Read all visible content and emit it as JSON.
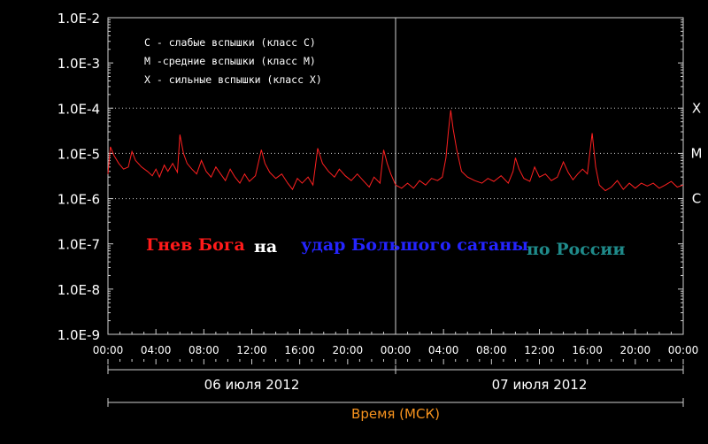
{
  "chart_data": {
    "type": "line",
    "y_scale": "log",
    "ylim": [
      1e-09,
      0.01
    ],
    "xlim_hours": [
      0,
      48
    ],
    "y_tick_labels": [
      "1.0E-2",
      "1.0E-3",
      "1.0E-4",
      "1.0E-5",
      "1.0E-6",
      "1.0E-7",
      "1.0E-8",
      "1.0E-9"
    ],
    "x_tick_labels": [
      "00:00",
      "04:00",
      "08:00",
      "12:00",
      "16:00",
      "20:00",
      "00:00",
      "04:00",
      "08:00",
      "12:00",
      "16:00",
      "20:00",
      "00:00"
    ],
    "class_levels": [
      {
        "label": "X",
        "value": 0.0001
      },
      {
        "label": "M",
        "value": 1e-05
      },
      {
        "label": "C",
        "value": 1e-06
      }
    ],
    "legend": [
      "C - слабые вспышки (класс C)",
      "M -средние вспышки (класс M)",
      "X - сильные вспышки (класс X)"
    ],
    "date_labels": [
      "06 июля 2012",
      "07 июля 2012"
    ],
    "xlabel": "Время (МСК)",
    "series": [
      {
        "color": "#ff2020",
        "points": [
          [
            0.0,
            3.5e-06
          ],
          [
            0.2,
            1.4e-05
          ],
          [
            0.5,
            9e-06
          ],
          [
            0.9,
            6e-06
          ],
          [
            1.3,
            4.5e-06
          ],
          [
            1.7,
            5e-06
          ],
          [
            2.0,
            1.1e-05
          ],
          [
            2.3,
            7e-06
          ],
          [
            2.8,
            5e-06
          ],
          [
            3.3,
            4e-06
          ],
          [
            3.7,
            3.2e-06
          ],
          [
            4.0,
            4.5e-06
          ],
          [
            4.3,
            3e-06
          ],
          [
            4.7,
            5.5e-06
          ],
          [
            5.0,
            4e-06
          ],
          [
            5.4,
            6e-06
          ],
          [
            5.8,
            3.8e-06
          ],
          [
            6.0,
            2.6e-05
          ],
          [
            6.3,
            1e-05
          ],
          [
            6.6,
            6e-06
          ],
          [
            7.0,
            4.5e-06
          ],
          [
            7.4,
            3.5e-06
          ],
          [
            7.8,
            7e-06
          ],
          [
            8.2,
            4e-06
          ],
          [
            8.6,
            3e-06
          ],
          [
            9.0,
            5e-06
          ],
          [
            9.4,
            3.5e-06
          ],
          [
            9.8,
            2.5e-06
          ],
          [
            10.2,
            4.5e-06
          ],
          [
            10.6,
            3e-06
          ],
          [
            11.0,
            2.2e-06
          ],
          [
            11.4,
            3.5e-06
          ],
          [
            11.8,
            2.4e-06
          ],
          [
            12.3,
            3.2e-06
          ],
          [
            12.8,
            1.2e-05
          ],
          [
            13.1,
            6e-06
          ],
          [
            13.5,
            3.8e-06
          ],
          [
            14.0,
            2.8e-06
          ],
          [
            14.5,
            3.5e-06
          ],
          [
            15.0,
            2.2e-06
          ],
          [
            15.4,
            1.6e-06
          ],
          [
            15.8,
            2.8e-06
          ],
          [
            16.2,
            2.2e-06
          ],
          [
            16.7,
            3e-06
          ],
          [
            17.1,
            2e-06
          ],
          [
            17.5,
            1.3e-05
          ],
          [
            17.9,
            6e-06
          ],
          [
            18.4,
            4e-06
          ],
          [
            18.9,
            3e-06
          ],
          [
            19.3,
            4.5e-06
          ],
          [
            19.8,
            3.2e-06
          ],
          [
            20.3,
            2.5e-06
          ],
          [
            20.8,
            3.5e-06
          ],
          [
            21.3,
            2.5e-06
          ],
          [
            21.8,
            1.8e-06
          ],
          [
            22.2,
            3e-06
          ],
          [
            22.7,
            2.2e-06
          ],
          [
            23.0,
            1.2e-05
          ],
          [
            23.3,
            6e-06
          ],
          [
            23.6,
            3.5e-06
          ],
          [
            24.0,
            2e-06
          ],
          [
            24.5,
            1.7e-06
          ],
          [
            25.0,
            2.2e-06
          ],
          [
            25.5,
            1.7e-06
          ],
          [
            26.0,
            2.5e-06
          ],
          [
            26.5,
            2e-06
          ],
          [
            27.0,
            2.8e-06
          ],
          [
            27.5,
            2.5e-06
          ],
          [
            27.9,
            3e-06
          ],
          [
            28.2,
            8e-06
          ],
          [
            28.4,
            3e-05
          ],
          [
            28.6,
            9e-05
          ],
          [
            28.8,
            3.5e-05
          ],
          [
            29.1,
            1.2e-05
          ],
          [
            29.5,
            4e-06
          ],
          [
            30.0,
            3e-06
          ],
          [
            30.6,
            2.5e-06
          ],
          [
            31.2,
            2.2e-06
          ],
          [
            31.7,
            2.8e-06
          ],
          [
            32.2,
            2.4e-06
          ],
          [
            32.8,
            3.2e-06
          ],
          [
            33.4,
            2.2e-06
          ],
          [
            33.8,
            4e-06
          ],
          [
            34.0,
            8e-06
          ],
          [
            34.3,
            4.5e-06
          ],
          [
            34.7,
            2.8e-06
          ],
          [
            35.2,
            2.4e-06
          ],
          [
            35.6,
            5e-06
          ],
          [
            36.0,
            3e-06
          ],
          [
            36.5,
            3.5e-06
          ],
          [
            37.0,
            2.5e-06
          ],
          [
            37.5,
            3e-06
          ],
          [
            38.0,
            6.5e-06
          ],
          [
            38.4,
            3.8e-06
          ],
          [
            38.8,
            2.6e-06
          ],
          [
            39.2,
            3.5e-06
          ],
          [
            39.6,
            4.5e-06
          ],
          [
            40.0,
            3.5e-06
          ],
          [
            40.4,
            2.8e-05
          ],
          [
            40.7,
            5e-06
          ],
          [
            41.0,
            2e-06
          ],
          [
            41.5,
            1.5e-06
          ],
          [
            42.0,
            1.8e-06
          ],
          [
            42.5,
            2.5e-06
          ],
          [
            43.0,
            1.6e-06
          ],
          [
            43.5,
            2.2e-06
          ],
          [
            44.0,
            1.7e-06
          ],
          [
            44.5,
            2.2e-06
          ],
          [
            45.0,
            1.9e-06
          ],
          [
            45.5,
            2.2e-06
          ],
          [
            46.0,
            1.7e-06
          ],
          [
            46.5,
            2e-06
          ],
          [
            47.0,
            2.4e-06
          ],
          [
            47.5,
            1.8e-06
          ],
          [
            48.0,
            2e-06
          ]
        ]
      }
    ]
  },
  "overlay_texts": [
    {
      "text": "Гнев Бога",
      "color": "#ff1a1a"
    },
    {
      "text": "на",
      "color": "#ffffff"
    },
    {
      "text": "удар Большого сатаны",
      "color": "#2424ff"
    },
    {
      "text": "по России",
      "color": "#1f8a8a"
    }
  ]
}
